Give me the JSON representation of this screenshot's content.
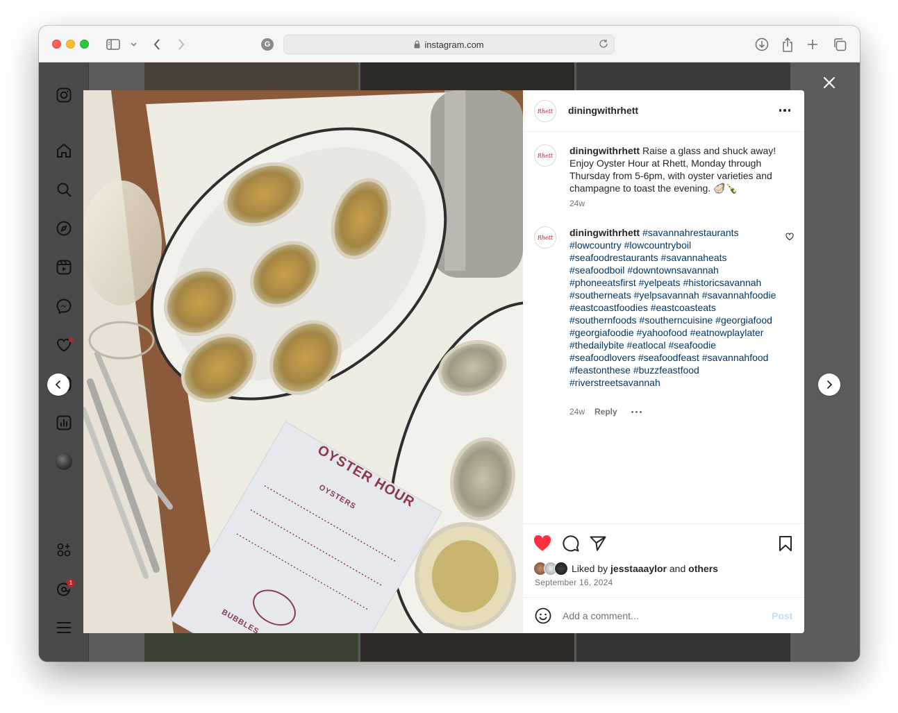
{
  "browser": {
    "url": "instagram.com"
  },
  "post": {
    "username": "diningwithrhett",
    "avatar_text": "Rhett",
    "caption": {
      "username": "diningwithrhett",
      "text": "Raise a glass and shuck away! Enjoy Oyster Hour at Rhett, Monday through Thursday from 5-6pm, with oyster varieties and champagne to toast the evening. 🦪🍾",
      "time": "24w"
    },
    "reply": {
      "username": "diningwithrhett",
      "hashtags": [
        "#savannahrestaurants",
        "#lowcountry",
        "#lowcountryboil",
        "#seafoodrestaurants",
        "#savannaheats",
        "#seafoodboil",
        "#downtownsavannah",
        "#phoneeatsfirst",
        "#yelpeats",
        "#historicsavannah",
        "#southerneats",
        "#yelpsavannah",
        "#savannahfoodie",
        "#eastcoastfoodies",
        "#eastcoasteats",
        "#southernfoods",
        "#southerncuisine",
        "#georgiafood",
        "#georgiafoodie",
        "#yahoofood",
        "#eatnowplaylater",
        "#thedailybite",
        "#eatlocal",
        "#seafoodie",
        "#seafoodlovers",
        "#seafoodfeast",
        "#savannahfood",
        "#feastonthese",
        "#buzzfeastfood",
        "#riverstreetsavannah"
      ],
      "time": "24w",
      "reply_label": "Reply"
    },
    "liked_by_prefix": "Liked by",
    "liked_by_user": "jesstaaaylor",
    "liked_by_and": "and",
    "liked_by_others": "others",
    "date": "September 16, 2024",
    "add_comment_placeholder": "Add a comment...",
    "post_button": "Post",
    "liked": true
  },
  "photo": {
    "menu_title": "OYSTER HOUR",
    "menu_heading": "OYSTERS",
    "menu_bubbles": "BUBBLES"
  },
  "sidebar": {
    "notifications_badge": "1"
  },
  "colors": {
    "like_red": "#ff3040",
    "hashtag_blue": "#00376b",
    "brand_red": "#b3262d"
  }
}
